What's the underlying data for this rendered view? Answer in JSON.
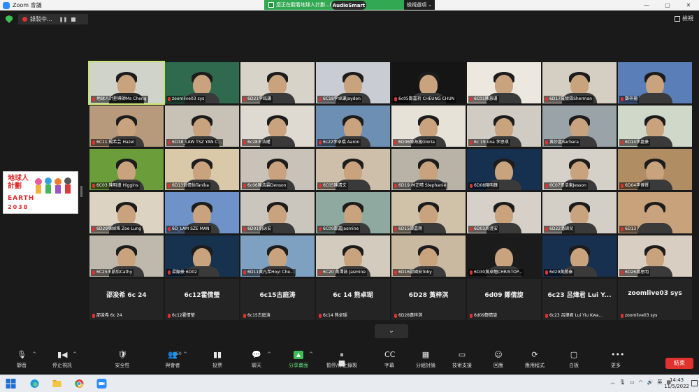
{
  "window": {
    "title": "Zoom 會議",
    "controls": [
      "—",
      "▢",
      "✕"
    ]
  },
  "share_banner": {
    "text": "您正在觀看地球人計劃...的螢幕",
    "view_option": "檢視選項 ⌄",
    "audio_badge": "AudioSmart"
  },
  "recording": {
    "label": "錄製中..."
  },
  "view_button": {
    "label": "檢視"
  },
  "logo": {
    "line1": "地球人",
    "line2": "計劃",
    "line3": "EARTH",
    "line4": "2038"
  },
  "participants": [
    {
      "name": "地球人計劃導師Ms Cheng",
      "bg": "#cfd3c9",
      "kind": "host"
    },
    {
      "name": "zoomlive03 sys",
      "bg": "#2f6a4f",
      "kind": "person"
    },
    {
      "name": "6D21李銘謙",
      "bg": "#d8d3c8",
      "kind": "person"
    },
    {
      "name": "6C18李卓謙Jayden",
      "bg": "#c9ccd2",
      "kind": "person"
    },
    {
      "name": "6c05鄭嘉祈 CHEUNG CHUN",
      "bg": "#151515",
      "kind": "person"
    },
    {
      "name": "6C01陳慧珊",
      "bg": "#ece7df",
      "kind": "person"
    },
    {
      "name": "6D17羅駿霖Sherman",
      "bg": "#d5cec2",
      "kind": "person"
    },
    {
      "name": "鄭梓揚",
      "bg": "#5a7fb8",
      "kind": "person"
    },
    {
      "name": "6C11 楊希芸 Hazel",
      "bg": "#b79a7c",
      "kind": "person"
    },
    {
      "name": "6D18_LAW TSZ YAN C...",
      "bg": "#c7c1b6",
      "kind": "person"
    },
    {
      "name": "6c28王浩權",
      "bg": "#dfdad1",
      "kind": "person"
    },
    {
      "name": "6c22李卓橋 Aaron",
      "bg": "#6d8fb3",
      "kind": "person"
    },
    {
      "name": "6D06陳海嵐Gloria",
      "bg": "#e6e2d8",
      "kind": "person"
    },
    {
      "name": "6c 19 una 李思琪",
      "bg": "#d0ccc4",
      "kind": "person"
    },
    {
      "name": "黃妙嘉Barbara",
      "bg": "#9aa3a8",
      "kind": "person"
    },
    {
      "name": "6D14李嘉豪",
      "bg": "#cfd8c9",
      "kind": "person"
    },
    {
      "name": "6C03 陳明潼 Higgins",
      "bg": "#6b9e3a",
      "kind": "person"
    },
    {
      "name": "6D13鄧倩怡Tanika",
      "bg": "#d9c9a8",
      "kind": "person"
    },
    {
      "name": "6c06陳浩霖Denson",
      "bg": "#c8c2b8",
      "kind": "person"
    },
    {
      "name": "6C05陳清文",
      "bg": "#cdbfa9",
      "kind": "person"
    },
    {
      "name": "6D19 林芷晴 Stephanie",
      "bg": "#b9b2a7",
      "kind": "person"
    },
    {
      "name": "6D08陳明鋒",
      "bg": "#16304f",
      "kind": "person"
    },
    {
      "name": "6C07張浩東Jesson",
      "bg": "#d6d1c8",
      "kind": "person"
    },
    {
      "name": "6D04李博賢",
      "bg": "#b08d63",
      "kind": "person"
    },
    {
      "name": "6D29陳綽瑤 Zoe Lung",
      "bg": "#ddd3c3",
      "kind": "person"
    },
    {
      "name": "6D_LAM SZE MAN",
      "bg": "#6f93c9",
      "kind": "person"
    },
    {
      "name": "6D01劉詠安",
      "bg": "#cbc6bd",
      "kind": "person"
    },
    {
      "name": "6C09鄭嘉Jasmine",
      "bg": "#8fa9a0",
      "kind": "person"
    },
    {
      "name": "6D15譚嘉雨",
      "bg": "#cfc2a9",
      "kind": "person"
    },
    {
      "name": "6D03周澄安",
      "bg": "#d6d0c8",
      "kind": "person"
    },
    {
      "name": "6D22潘錦兒",
      "bg": "#d3cfc7",
      "kind": "person"
    },
    {
      "name": "6D13",
      "bg": "#c7a27a",
      "kind": "person"
    },
    {
      "name": "6C25王凱怡Cathy",
      "bg": "#bfb8ad",
      "kind": "person"
    },
    {
      "name": "梁顯豪 6D02",
      "bg": "#17324f",
      "kind": "person"
    },
    {
      "name": "6D11黃凡希Hoyi Che...",
      "bg": "#7ea1c2",
      "kind": "person"
    },
    {
      "name": "6C20 黃澤詠 Jasmine",
      "bg": "#d3cbbd",
      "kind": "person"
    },
    {
      "name": "6D16尉國安Toby",
      "bg": "#c9b9a0",
      "kind": "person"
    },
    {
      "name": "6D30黃卓翹CHRISTOP...",
      "bg": "#1b1b1b",
      "kind": "person"
    },
    {
      "name": "6d29黃勝泰",
      "bg": "#173050",
      "kind": "person"
    },
    {
      "name": "6D26蕭思明",
      "bg": "#d8cfc2",
      "kind": "person"
    },
    {
      "name": "邵浚希 6c 24",
      "big": "邵浚希 6c 24",
      "kind": "text"
    },
    {
      "name": "6c12霍倩瑩",
      "big": "6c12霍倩瑩",
      "kind": "text"
    },
    {
      "name": "6c15古庭涛",
      "big": "6c15古庭涛",
      "kind": "text"
    },
    {
      "name": "6c14 熊卓瑚",
      "big": "6c 14 熊卓瑚",
      "kind": "text"
    },
    {
      "name": "6D28黃梓淇",
      "big": "6D28 黃梓淇",
      "kind": "text"
    },
    {
      "name": "6d09鄭倩旋",
      "big": "6d09 鄭倩旋",
      "kind": "text"
    },
    {
      "name": "6c23 呂煒君 Lui Yiu Kwa...",
      "big": "6c23 呂煒君 Lui Y...",
      "kind": "text"
    },
    {
      "name": "zoomlive03 sys",
      "big": "zoomlive03 sys",
      "kind": "text"
    }
  ],
  "toolbar": {
    "items": [
      {
        "label": "靜音",
        "icon": "🎙",
        "name": "mute-button",
        "caret": true
      },
      {
        "label": "停止視訊",
        "icon": "▮◀",
        "name": "stop-video-button",
        "caret": true
      },
      {
        "label": "安全性",
        "icon": "🛡",
        "name": "security-button"
      },
      {
        "label": "與會者",
        "icon": "👥",
        "name": "participants-button",
        "count": "50",
        "caret": true
      },
      {
        "label": "投票",
        "icon": "▮▮",
        "name": "polls-button"
      },
      {
        "label": "聊天",
        "icon": "💬",
        "name": "chat-button",
        "caret": true
      },
      {
        "label": "分享畫面",
        "icon": "▲",
        "name": "share-screen-button",
        "green": true,
        "caret": true
      },
      {
        "label": "暫停/停止錄製",
        "icon": "⏸ ■",
        "name": "pause-stop-recording-button"
      },
      {
        "label": "字幕",
        "icon": "CC",
        "name": "captions-button"
      },
      {
        "label": "分組討論",
        "icon": "▦",
        "name": "breakout-rooms-button"
      },
      {
        "label": "技術支援",
        "icon": "▭",
        "name": "tech-support-button"
      },
      {
        "label": "回應",
        "icon": "☺",
        "name": "reactions-button"
      },
      {
        "label": "應用程式",
        "icon": "⟳",
        "name": "apps-button"
      },
      {
        "label": "白板",
        "icon": "▢",
        "name": "whiteboard-button"
      },
      {
        "label": "更多",
        "icon": "•••",
        "name": "more-button"
      }
    ],
    "end_label": "結束"
  },
  "taskbar": {
    "language": "英",
    "time": "14:43",
    "date": "11/5/2022"
  }
}
